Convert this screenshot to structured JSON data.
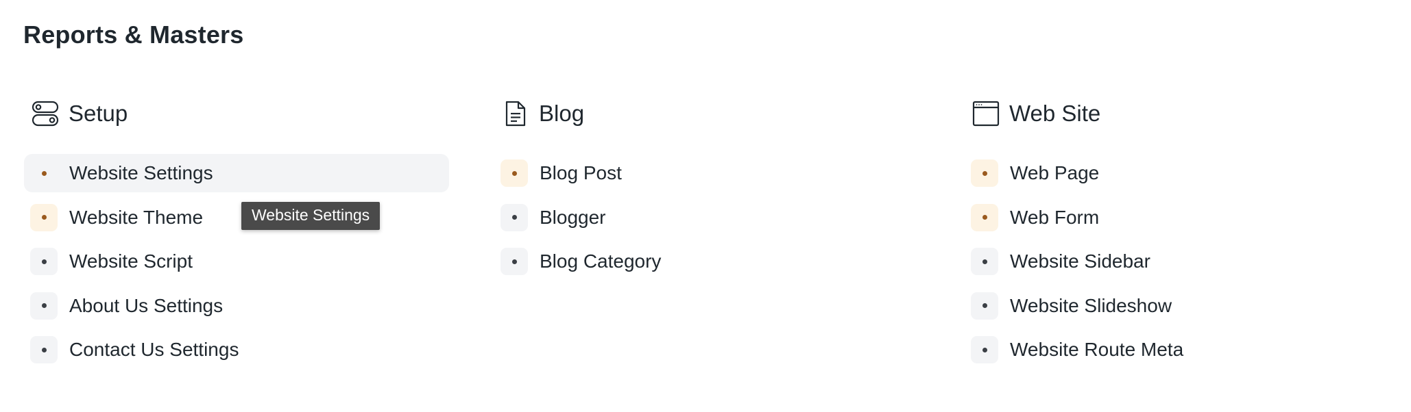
{
  "page": {
    "title": "Reports & Masters"
  },
  "sections": [
    {
      "title": "Setup",
      "icon": "toggle-icon",
      "items": [
        {
          "label": "Website Settings",
          "indicator": "warm"
        },
        {
          "label": "Website Theme",
          "indicator": "warm"
        },
        {
          "label": "Website Script",
          "indicator": "neutral"
        },
        {
          "label": "About Us Settings",
          "indicator": "neutral"
        },
        {
          "label": "Contact Us Settings",
          "indicator": "neutral"
        }
      ]
    },
    {
      "title": "Blog",
      "icon": "document-icon",
      "items": [
        {
          "label": "Blog Post",
          "indicator": "warm"
        },
        {
          "label": "Blogger",
          "indicator": "neutral"
        },
        {
          "label": "Blog Category",
          "indicator": "neutral"
        }
      ]
    },
    {
      "title": "Web Site",
      "icon": "browser-window-icon",
      "items": [
        {
          "label": "Web Page",
          "indicator": "warm"
        },
        {
          "label": "Web Form",
          "indicator": "warm"
        },
        {
          "label": "Website Sidebar",
          "indicator": "neutral"
        },
        {
          "label": "Website Slideshow",
          "indicator": "neutral"
        },
        {
          "label": "Website Route Meta",
          "indicator": "neutral"
        }
      ]
    }
  ],
  "tooltip": {
    "text": "Website Settings"
  },
  "colors": {
    "text": "#1f272e",
    "hover_background": "#f3f4f6",
    "indicator_warm_background": "#fdf3e3",
    "indicator_warm_dot": "#9a5a1e",
    "indicator_neutral_background": "#f3f4f6",
    "indicator_neutral_dot": "#3b3f45",
    "tooltip_background": "#4a4a4a"
  }
}
